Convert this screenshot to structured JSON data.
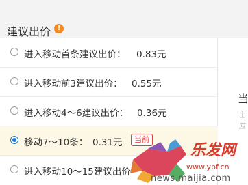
{
  "header": {
    "title": "建议出价",
    "info_icon": "info-icon"
  },
  "options": [
    {
      "label": "进入移动首条建议出价：",
      "price": "0.83元",
      "selected": false
    },
    {
      "label": "进入移动前3建议出价：",
      "price": "0.55元",
      "selected": false
    },
    {
      "label": "进入移动4～6建议出价：",
      "price": "0.36元",
      "selected": false
    },
    {
      "label": "移动7～10条：",
      "price": "0.31元",
      "selected": true,
      "badge": "当前"
    },
    {
      "label": "进入移动10～15建议出价",
      "price": "",
      "selected": false
    }
  ],
  "side": {
    "title": "当",
    "sub1": "由",
    "sub2": "应"
  },
  "watermark": {
    "brand": "乐发网",
    "url": "www.ypf.cn",
    "domain": "news.maijia.com"
  },
  "colors": {
    "accent": "#1a7bd1",
    "badge": "#e04040",
    "info": "#f08a24",
    "selected_bg": "#fdf8e6"
  }
}
